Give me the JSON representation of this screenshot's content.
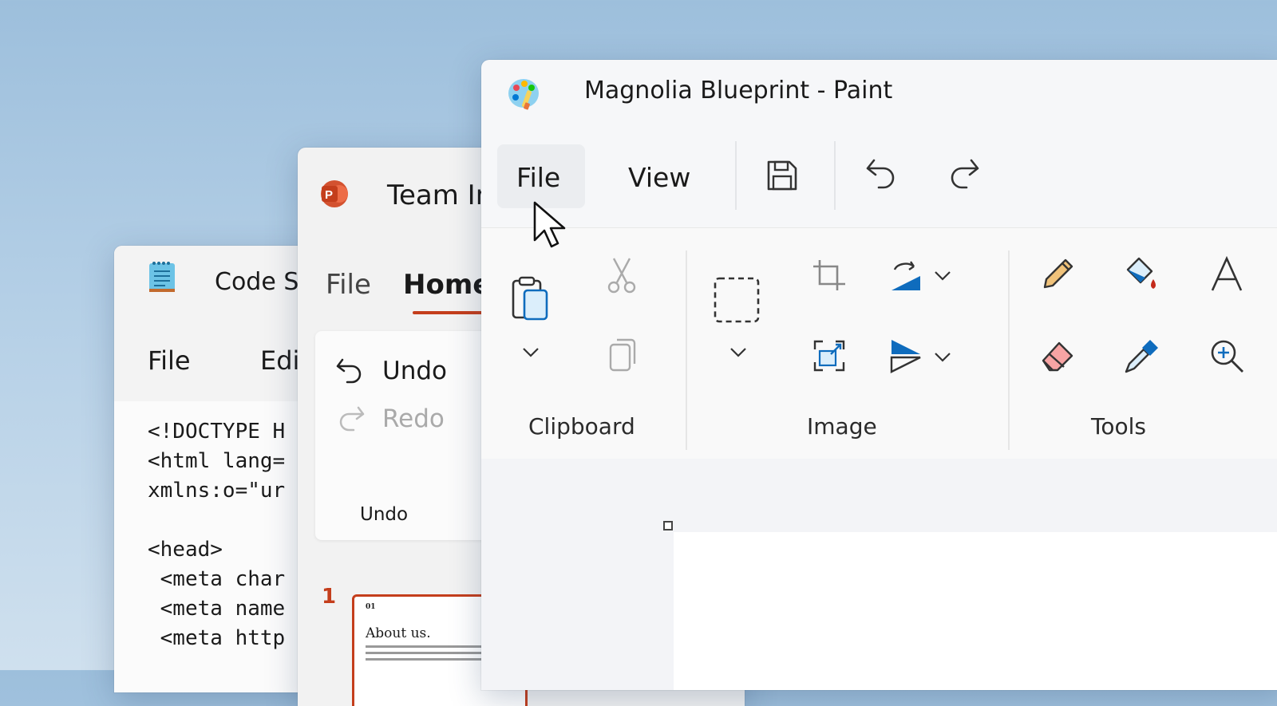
{
  "notepad": {
    "title": "Code Sn",
    "menu": {
      "file": "File",
      "edit": "Edi"
    },
    "code_lines": [
      "<!DOCTYPE H",
      "<html lang=",
      "xmlns:o=\"ur",
      "",
      "<head>",
      " <meta char",
      " <meta name",
      " <meta http"
    ]
  },
  "powerpoint": {
    "title": "Team In",
    "tabs": {
      "file": "File",
      "home": "Home"
    },
    "undo_label": "Undo",
    "redo_label": "Redo",
    "group_label": "Undo",
    "slide_number": "1",
    "slide_thumb": {
      "small_heading": "01",
      "heading": "About us."
    }
  },
  "paint": {
    "title": "Magnolia Blueprint - Paint",
    "menu": {
      "file": "File",
      "view": "View"
    },
    "groups": {
      "clipboard": "Clipboard",
      "image": "Image",
      "tools": "Tools"
    }
  },
  "colors": {
    "accent_blue": "#0f6cbd",
    "ppt_red": "#c43e1c",
    "eraser_pink": "#f7a4a4",
    "pencil_yellow": "#f0c27a"
  }
}
